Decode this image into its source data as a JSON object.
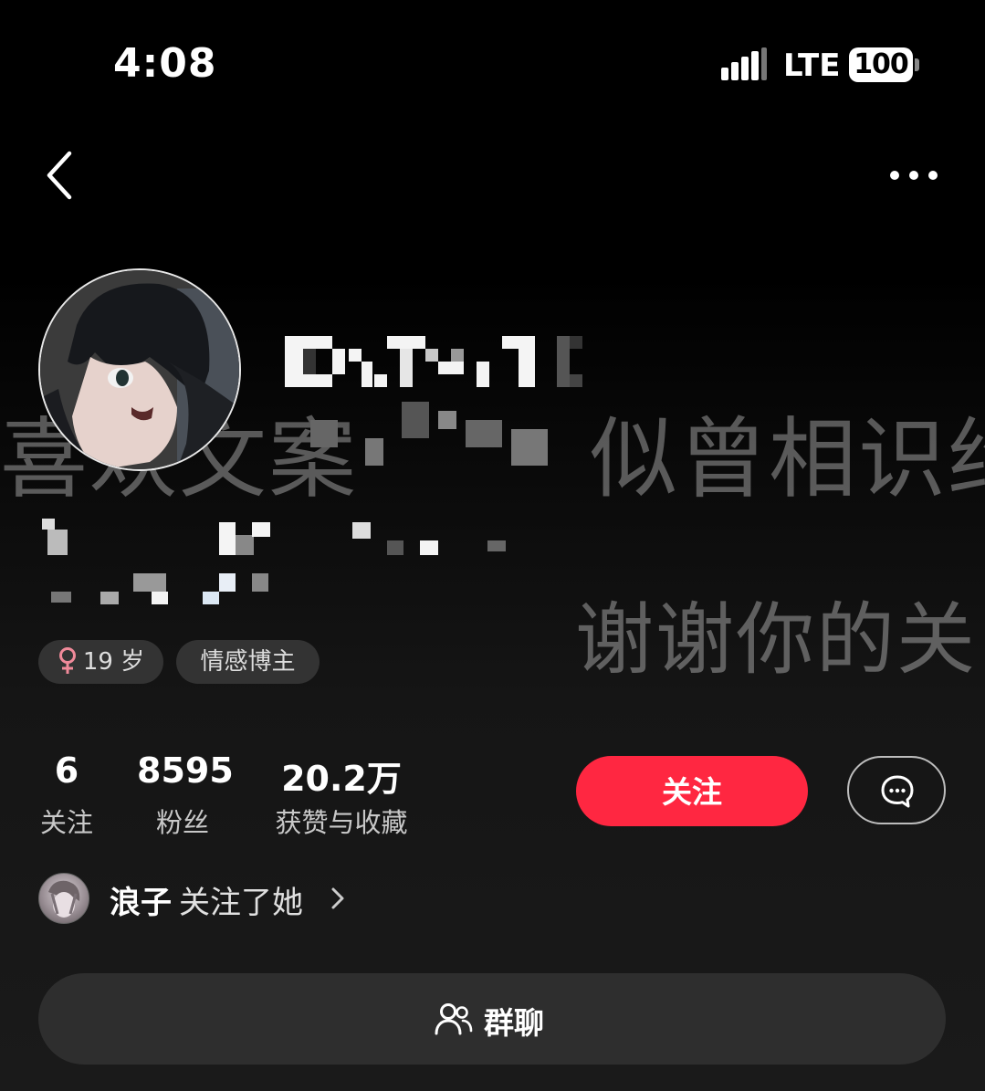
{
  "status_bar": {
    "time": "4:08",
    "network": "LTE",
    "battery": "100"
  },
  "nav": {
    "back_icon": "chevron-left-icon",
    "more_icon": "more-horizontal-icon"
  },
  "background_text": {
    "line1": "喜欢文案",
    "line1_tail": "似曾相识约",
    "line2": "谢谢你的关"
  },
  "tags": {
    "age": "19 岁",
    "age_icon": "female-icon",
    "age_icon_color": "#f08a9a",
    "role": "情感博主"
  },
  "stats": [
    {
      "value": "6",
      "label": "关注"
    },
    {
      "value": "8595",
      "label": "粉丝"
    },
    {
      "value": "20.2万",
      "label": "获赞与收藏"
    }
  ],
  "actions": {
    "follow_label": "关注",
    "follow_color": "#ff2741",
    "message_icon": "chat-bubble-icon"
  },
  "followed_by": {
    "name": "浪子",
    "text": "关注了她"
  },
  "group_chat": {
    "label": "群聊",
    "icon": "group-icon"
  }
}
